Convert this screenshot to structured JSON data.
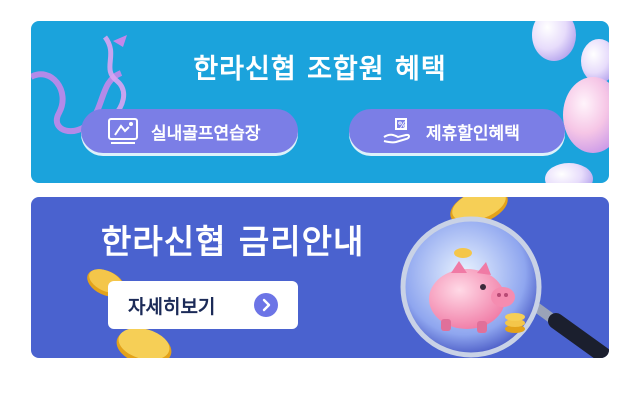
{
  "benefit_banner": {
    "title": "한라신협 조합원 혜택",
    "buttons": [
      {
        "label": "실내골프연습장",
        "icon": "golf-screen-icon"
      },
      {
        "label": "제휴할인혜택",
        "icon": "discount-hand-icon"
      }
    ]
  },
  "rate_banner": {
    "title": "한라신협 금리안내",
    "more_label": "자세히보기",
    "more_icon": "chevron-right-circle-icon",
    "illustration": "magnifier-piggy-bank"
  },
  "colors": {
    "benefit_bg": "#1ba3dc",
    "rate_bg": "#4a62cf",
    "pill": "#7b7ee6",
    "arrow": "#6c74e6"
  }
}
